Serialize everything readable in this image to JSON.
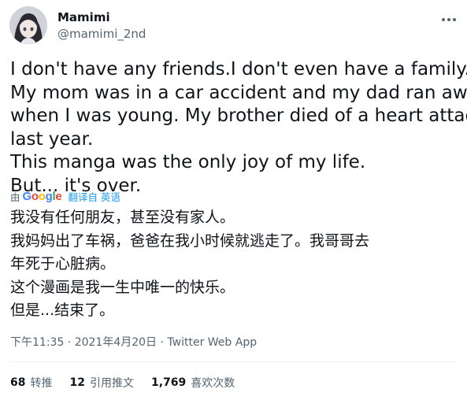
{
  "author": {
    "display_name": "Mamimi",
    "username": "@mamimi_2nd",
    "avatar_icon": "avatar-image"
  },
  "tweet": {
    "lines": [
      "I don't have any friends.I don't even have a family.",
      "My mom was in a car accident and my dad ran away",
      "when I was young. My brother died of a heart attack",
      "last year.",
      "This manga was the only joy of my life.",
      "But... it's over."
    ]
  },
  "translation_bar": {
    "by_label": "由",
    "provider": "Google",
    "link": "翻译自 英语"
  },
  "translation": {
    "lines": [
      "我没有任何朋友，甚至没有家人。",
      "我妈妈出了车祸，爸爸在我小时候就逃走了。我哥哥去",
      "年死于心脏病。",
      "这个漫画是我一生中唯一的快乐。",
      "但是...结束了。"
    ]
  },
  "meta": {
    "text": "下午11:35 · 2021年4月20日 · Twitter Web App"
  },
  "stats": {
    "retweets_count": "68",
    "retweets_label": "转推",
    "quotes_count": "12",
    "quotes_label": "引用推文",
    "likes_count": "1,769",
    "likes_label": "喜欢次数"
  },
  "icons": {
    "more": "more-dots-icon"
  },
  "colors": {
    "text": "#0f1419",
    "secondary": "#536471",
    "link": "#1d9bf0",
    "divider": "#eff3f4"
  }
}
